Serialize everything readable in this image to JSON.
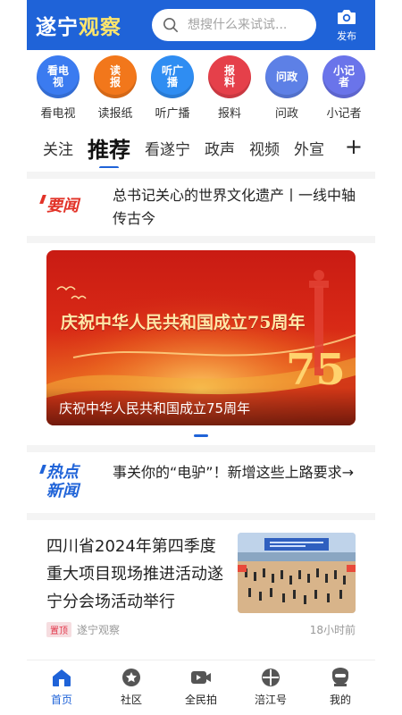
{
  "header": {
    "logo_part1": "遂宁",
    "logo_part2": "观察",
    "search_placeholder": "想搜什么来试试...",
    "publish_label": "发布"
  },
  "channels": [
    {
      "label": "看电视",
      "icon_text": "看电\n视",
      "icon": "tv-channel-icon",
      "color": "#3b7bf0"
    },
    {
      "label": "读报纸",
      "icon_text": "读\n报",
      "icon": "newspaper-channel-icon",
      "color": "#f2771b"
    },
    {
      "label": "听广播",
      "icon_text": "听广\n播",
      "icon": "radio-channel-icon",
      "color": "#2f8df2"
    },
    {
      "label": "报料",
      "icon_text": "报\n料",
      "icon": "tipoff-channel-icon",
      "color": "#e5404a"
    },
    {
      "label": "问政",
      "icon_text": "问政",
      "icon": "inquiry-channel-icon",
      "color": "#5d80e6"
    },
    {
      "label": "小记者",
      "icon_text": "小记\n者",
      "icon": "young-reporter-channel-icon",
      "color": "#6a74ea"
    }
  ],
  "tabs": [
    "关注",
    "推荐",
    "看遂宁",
    "政声",
    "视频",
    "外宣"
  ],
  "tabs_active_index": 1,
  "tab_add_label": "+",
  "important_news": {
    "badge": "要闻",
    "text": "总书记关心的世界文化遗产丨一线中轴传古今"
  },
  "banner": {
    "headline": "庆祝中华人民共和国成立75周年",
    "number": "75",
    "caption": "庆祝中华人民共和国成立75周年"
  },
  "hot_news": {
    "badge_line1": "热点",
    "badge_line2": "新闻",
    "text": "事关你的“电驴”！新增这些上路要求→"
  },
  "article": {
    "title": "四川省2024年第四季度重大项目现场推进活动遂宁分会场活动举行",
    "pin_label": "置顶",
    "source": "遂宁观察",
    "time": "18小时前"
  },
  "bottom_nav": [
    {
      "label": "首页",
      "icon": "home-icon",
      "active": true
    },
    {
      "label": "社区",
      "icon": "community-icon",
      "active": false
    },
    {
      "label": "全民拍",
      "icon": "video-camera-icon",
      "active": false
    },
    {
      "label": "涪江号",
      "icon": "fujiang-icon",
      "active": false
    },
    {
      "label": "我的",
      "icon": "profile-icon",
      "active": false
    }
  ],
  "colors": {
    "brand_blue": "#1f63d8",
    "accent_red": "#e23227",
    "logo_yellow": "#ffe66b"
  }
}
